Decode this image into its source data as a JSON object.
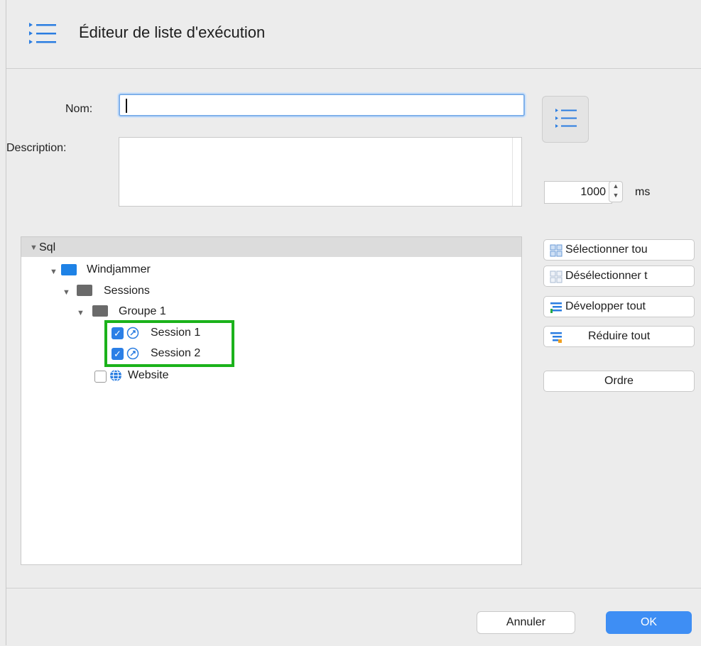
{
  "dialog": {
    "title": "Éditeur de liste d'exécution"
  },
  "form": {
    "name_label": "Nom:",
    "name_value": "",
    "description_label": "Description:",
    "description_value": "",
    "interval_value": "1000",
    "interval_unit": "ms"
  },
  "tree": {
    "root": "Sql",
    "items": [
      {
        "label": "Windjammer",
        "icon": "folder-blue-icon"
      },
      {
        "label": "Sessions",
        "icon": "folder-gray-icon"
      },
      {
        "label": "Groupe 1",
        "icon": "folder-gray-icon"
      },
      {
        "label": "Session 1",
        "icon": "session-icon",
        "checked": true
      },
      {
        "label": "Session 2",
        "icon": "session-icon",
        "checked": true
      },
      {
        "label": "Website",
        "icon": "globe-icon",
        "checked": false
      }
    ]
  },
  "side_buttons": {
    "select_all": "Sélectionner tou",
    "deselect_all": "Désélectionner t",
    "expand_all": "Développer tout",
    "collapse_all": "Réduire tout",
    "order": "Ordre"
  },
  "footer": {
    "cancel": "Annuler",
    "ok": "OK"
  },
  "colors": {
    "accent": "#3e8ef4",
    "highlight": "#1bb21b",
    "folder": "#1e82e6"
  }
}
